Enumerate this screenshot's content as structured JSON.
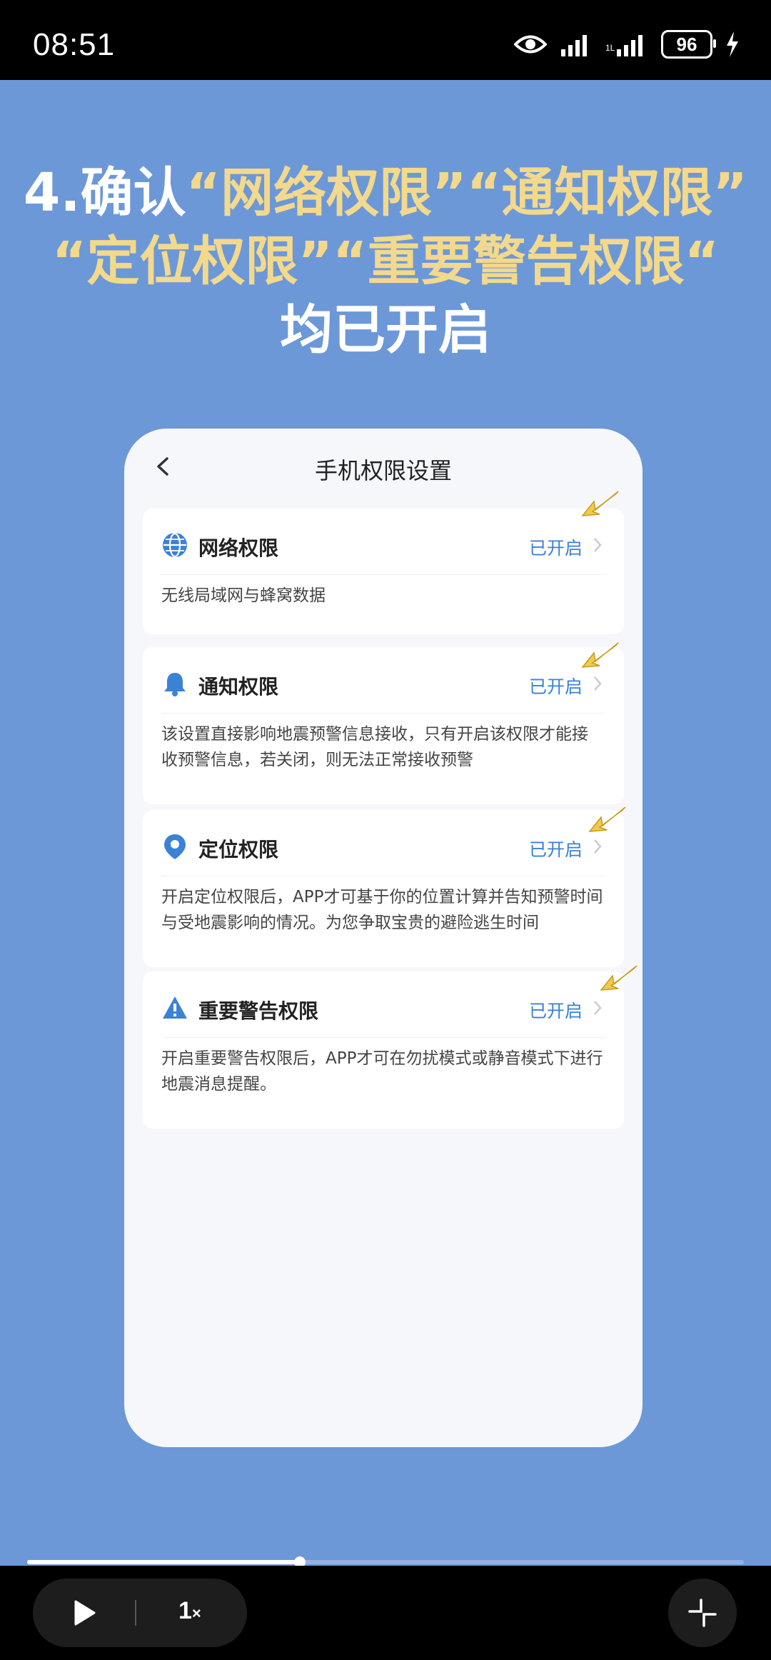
{
  "status_bar": {
    "time": "08:51",
    "battery": "96",
    "icons": [
      "eye-icon",
      "signal-icon",
      "signal-icon-2",
      "battery-icon",
      "charging-icon"
    ]
  },
  "headline": {
    "line1_prefix": "4.确认",
    "line1_a": "“网络权限”",
    "line1_b": "“通知权限”",
    "line2": "“定位权限”“重要警告权限“",
    "line3": "均已开启"
  },
  "phone": {
    "title": "手机权限设置",
    "permissions": [
      {
        "title": "网络权限",
        "status": "已开启",
        "icon": "globe-icon",
        "desc": "无线局域网与蜂窝数据"
      },
      {
        "title": "通知权限",
        "status": "已开启",
        "icon": "bell-icon",
        "desc": "该设置直接影响地震预警信息接收，只有开启该权限才能接收预警信息，若关闭，则无法正常接收预警"
      },
      {
        "title": "定位权限",
        "status": "已开启",
        "icon": "location-pin-icon",
        "desc": "开启定位权限后，APP才可基于你的位置计算并告知预警时间与受地震影响的情况。为您争取宝贵的避险逃生时间"
      },
      {
        "title": "重要警告权限",
        "status": "已开启",
        "icon": "warning-icon",
        "desc": "开启重要警告权限后，APP才可在勿扰模式或静音模式下进行地震消息提醒。"
      }
    ]
  },
  "player": {
    "speed": "1",
    "speed_suffix": "×",
    "progress": 0.38
  },
  "colors": {
    "background": "#6c98d8",
    "highlight": "#f3d98c",
    "status_blue": "#3a82d6"
  }
}
